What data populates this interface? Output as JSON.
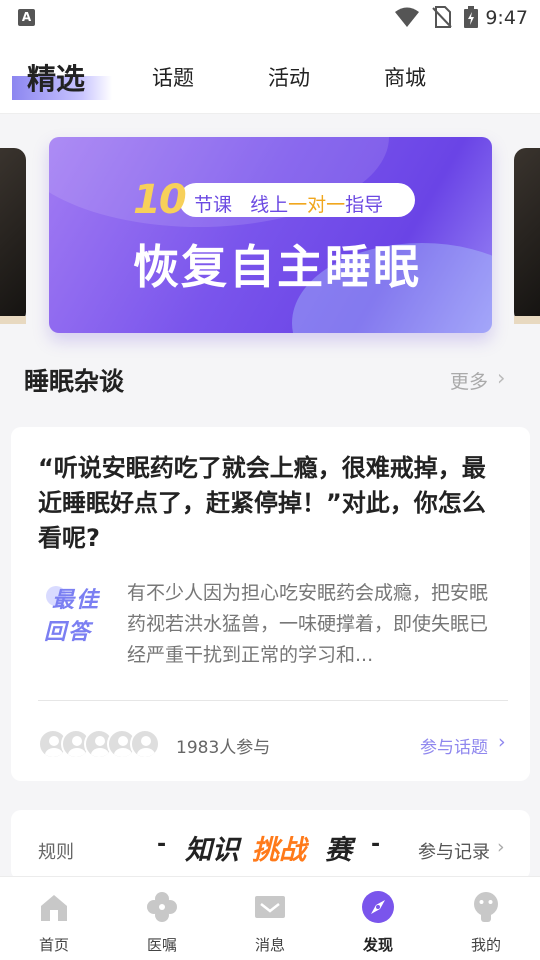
{
  "status_bar": {
    "time": "9:47",
    "sys_badge": "A"
  },
  "top_tabs": [
    {
      "label": "精选",
      "active": true
    },
    {
      "label": "话题"
    },
    {
      "label": "活动"
    },
    {
      "label": "商城"
    }
  ],
  "banner": {
    "number": "10",
    "pill_prefix": "节课   线上",
    "pill_highlight": "一对一",
    "pill_suffix": "指导",
    "title": "恢复自主睡眠"
  },
  "section": {
    "title": "睡眠杂谈",
    "more": "更多"
  },
  "topic_card": {
    "question": "“听说安眠药吃了就会上瘾，很难戒掉，最近睡眠好点了，赶紧停掉！”对此，你怎么看呢?",
    "badge_line1": "最佳",
    "badge_line2": "回答",
    "answer": "有不少人因为担心吃安眠药会成瘾，把安眠药视若洪水猛兽，一味硬撑着，即使失眠已经严重干扰到正常的学习和...",
    "participants": "1983人参与",
    "join_label": "参与话题"
  },
  "challenge_card": {
    "rule_label": "规则",
    "title_part1": "知识",
    "title_part2": "挑战",
    "title_part3": "赛",
    "dash_left": "-",
    "dash_right": "-",
    "record_label": "参与记录"
  },
  "bottom_nav": [
    {
      "label": "首页",
      "icon": "home-icon"
    },
    {
      "label": "医嘱",
      "icon": "clover-icon"
    },
    {
      "label": "消息",
      "icon": "message-icon"
    },
    {
      "label": "发现",
      "icon": "compass-icon",
      "active": true
    },
    {
      "label": "我的",
      "icon": "profile-icon"
    }
  ],
  "colors": {
    "accent": "#7a55ec",
    "link": "#8f87ee",
    "highlight": "#ff7a1a",
    "badge": "#7b7ff2"
  }
}
